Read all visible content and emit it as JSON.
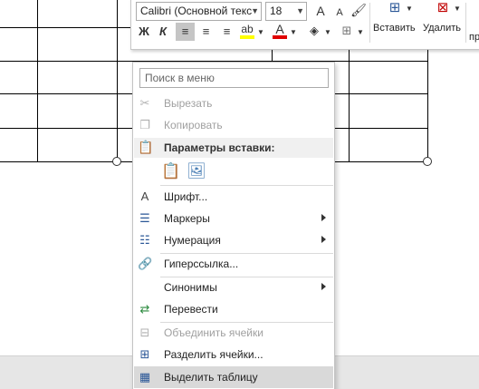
{
  "toolbar": {
    "font_name": "Calibri (Основной текс",
    "font_size": "18",
    "grow_font": "A",
    "shrink_font": "A",
    "bold": "Ж",
    "italic": "К",
    "insert_label": "Вставить",
    "delete_label": "Удалить",
    "partial_label": "пр"
  },
  "menu": {
    "search_placeholder": "Поиск в меню",
    "paste_header": "Параметры вставки:",
    "items": {
      "cut": "Вырезать",
      "copy": "Копировать",
      "font": "Шрифт...",
      "bullets": "Маркеры",
      "numbering": "Нумерация",
      "hyperlink": "Гиперссылка...",
      "synonyms": "Синонимы",
      "translate": "Перевести",
      "merge_cells": "Объединить ячейки",
      "split_cells": "Разделить ячейки...",
      "select_table": "Выделить таблицу"
    }
  },
  "colors": {
    "highlight_swatch": "#ffff00",
    "font_color_swatch": "#e00000",
    "hover_row": "#d9d9d9"
  }
}
